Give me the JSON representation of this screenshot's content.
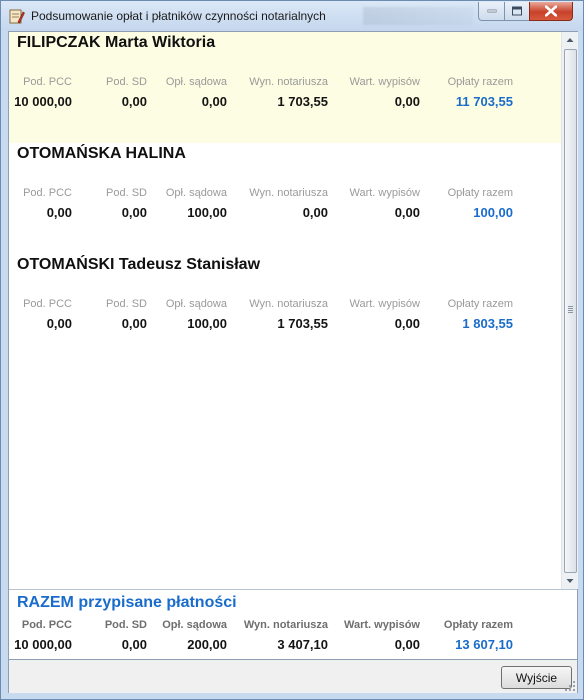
{
  "window": {
    "title": "Podsumowanie opłat i płatników czynności notarialnych"
  },
  "columns": [
    "Pod. PCC",
    "Pod. SD",
    "Opł. sądowa",
    "Wyn. notariusza",
    "Wart. wypisów",
    "Opłaty razem"
  ],
  "payers": [
    {
      "name": "FILIPCZAK Marta Wiktoria",
      "values": [
        "10 000,00",
        "0,00",
        "0,00",
        "1 703,55",
        "0,00",
        "11 703,55"
      ],
      "highlighted": true
    },
    {
      "name": "OTOMAŃSKA HALINA",
      "values": [
        "0,00",
        "0,00",
        "100,00",
        "0,00",
        "0,00",
        "100,00"
      ],
      "highlighted": false
    },
    {
      "name": "OTOMAŃSKI Tadeusz Stanisław",
      "values": [
        "0,00",
        "0,00",
        "100,00",
        "1 703,55",
        "0,00",
        "1 803,55"
      ],
      "highlighted": false
    }
  ],
  "summary": {
    "title": "RAZEM przypisane płatności",
    "values": [
      "10 000,00",
      "0,00",
      "200,00",
      "3 407,10",
      "0,00",
      "13 607,10"
    ]
  },
  "footer": {
    "exit_label": "Wyjście"
  },
  "colors": {
    "accent": "#1a6ccb",
    "highlight_row": "#fcfde2"
  },
  "icons": [
    "app-icon",
    "minimize-icon",
    "maximize-icon",
    "close-icon",
    "scroll-up-icon",
    "scroll-down-icon"
  ]
}
